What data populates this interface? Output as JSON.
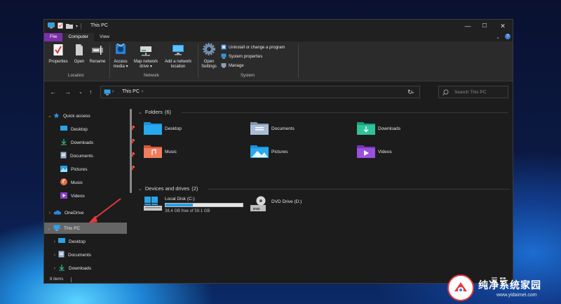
{
  "window": {
    "title": "This PC",
    "controls": {
      "minimize": "—",
      "maximize": "☐",
      "close": "✕"
    }
  },
  "ribbon": {
    "tabs": [
      "File",
      "Computer",
      "View"
    ],
    "active_tab": "Computer",
    "collapse": "⌄",
    "help": "?",
    "location_group": {
      "label": "Location",
      "buttons": [
        "Properties",
        "Open",
        "Rename"
      ]
    },
    "network_group": {
      "label": "Network",
      "buttons": [
        {
          "line1": "Access",
          "line2": "media ▾"
        },
        {
          "line1": "Map network",
          "line2": "drive ▾"
        },
        {
          "line1": "Add a network",
          "line2": "location"
        }
      ]
    },
    "system_group": {
      "label": "System",
      "open_settings": {
        "line1": "Open",
        "line2": "Settings"
      },
      "commands": [
        "Uninstall or change a program",
        "System properties",
        "Manage"
      ]
    }
  },
  "navigation": {
    "back": "←",
    "forward": "→",
    "recent": "⌄",
    "up": "↑",
    "breadcrumb": [
      "This PC"
    ],
    "separator": "›",
    "dropdown": "⌄",
    "refresh": "↻",
    "search_placeholder": "Search This PC"
  },
  "sidebar": {
    "quick_access": "Quick access",
    "quick_items": [
      {
        "label": "Desktop",
        "icon": "desktop-icon",
        "pinned": true
      },
      {
        "label": "Downloads",
        "icon": "downloads-icon",
        "pinned": true
      },
      {
        "label": "Documents",
        "icon": "documents-icon",
        "pinned": true
      },
      {
        "label": "Pictures",
        "icon": "pictures-icon",
        "pinned": true
      },
      {
        "label": "Music",
        "icon": "music-icon",
        "pinned": false
      },
      {
        "label": "Videos",
        "icon": "videos-icon",
        "pinned": false
      }
    ],
    "onedrive": "OneDrive",
    "this_pc": "This PC",
    "this_pc_items": [
      "Desktop",
      "Documents",
      "Downloads"
    ]
  },
  "content": {
    "folders_header": "Folders",
    "folders_count": "(6)",
    "folders": [
      {
        "label": "Desktop",
        "icon": "desktop-folder-icon"
      },
      {
        "label": "Documents",
        "icon": "documents-folder-icon"
      },
      {
        "label": "Downloads",
        "icon": "downloads-folder-icon"
      },
      {
        "label": "Music",
        "icon": "music-folder-icon"
      },
      {
        "label": "Pictures",
        "icon": "pictures-folder-icon"
      },
      {
        "label": "Videos",
        "icon": "videos-folder-icon"
      }
    ],
    "drives_header": "Devices and drives",
    "drives_count": "(2)",
    "drives": [
      {
        "label": "Local Disk (C:)",
        "free_text": "38.4 GB free of 59.1 GB",
        "used_fraction": 0.35
      },
      {
        "label": "DVD Drive (D:)",
        "badge": "DVD"
      }
    ]
  },
  "status": {
    "item_count": "8 items"
  },
  "watermark": {
    "title": "纯净系统家园",
    "url": "www.yidaimei.com"
  },
  "colors": {
    "accent_file_tab": "#7b2fa8",
    "selection": "#656565",
    "drive_bar": "#27a0e8",
    "annotation_arrow": "#e4393c"
  }
}
